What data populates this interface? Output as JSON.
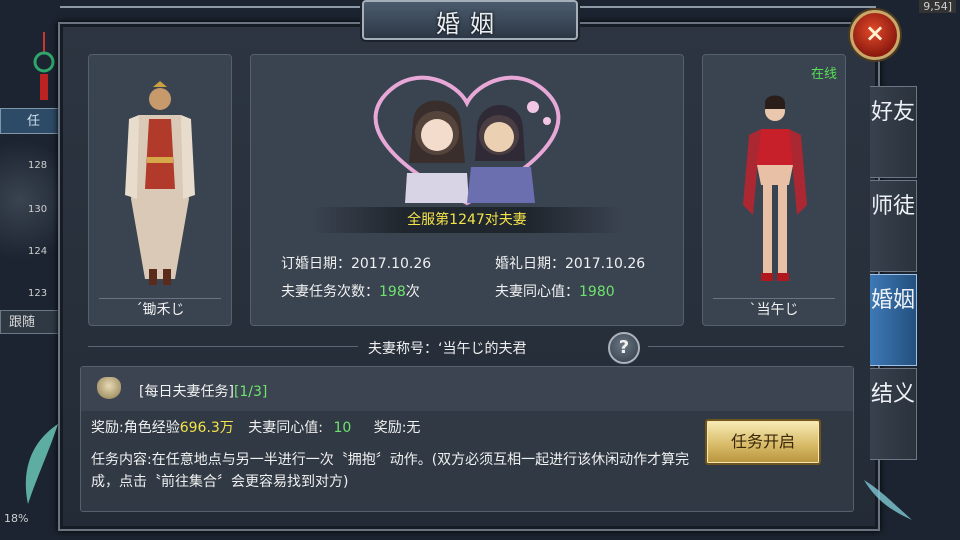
{
  "window": {
    "title": "婚姻",
    "close_icon": "×"
  },
  "background": {
    "left_tag": "任",
    "left_follow": "跟随",
    "left_nums": [
      "128",
      "130",
      "124",
      "123"
    ],
    "bottom_pct": "18%",
    "top_right_value": "9,54]"
  },
  "left_character": {
    "name": "ˊ锄禾じ"
  },
  "right_character": {
    "name": "ˋ当午じ",
    "status": "在线"
  },
  "couple": {
    "rank": "全服第1247对夫妻",
    "engage_label": "订婚日期：",
    "engage_date": "2017.10.26",
    "wedding_label": "婚礼日期：",
    "wedding_date": "2017.10.26",
    "task_count_label": "夫妻任务次数：",
    "task_count": "198",
    "task_count_unit": "次",
    "unity_label": "夫妻同心值：",
    "unity_value": "1980"
  },
  "title_row": {
    "label": "夫妻称号：‘当午じ的夫君",
    "help_icon": "?"
  },
  "task": {
    "title": "[每日夫妻任务]",
    "progress": "[1/3]",
    "reward_exp_label": "奖励:角色经验",
    "reward_exp_value": "696.3万",
    "reward_unity_label": "夫妻同心值:",
    "reward_unity_value": "10",
    "reward_other": "奖励:无",
    "description": "任务内容:在任意地点与另一半进行一次〝拥抱〞动作。(双方必须互相一起进行该休闲动作才算完成，点击〝前往集合〞会更容易找到对方)",
    "button": "任务开启"
  },
  "tabs": [
    {
      "label": "好友"
    },
    {
      "label": "师徒"
    },
    {
      "label": "婚姻"
    },
    {
      "label": "结义"
    }
  ],
  "colors": {
    "green": "#6ee46e",
    "yellow": "#f4e34a",
    "active_tab": "#3d79b6"
  }
}
